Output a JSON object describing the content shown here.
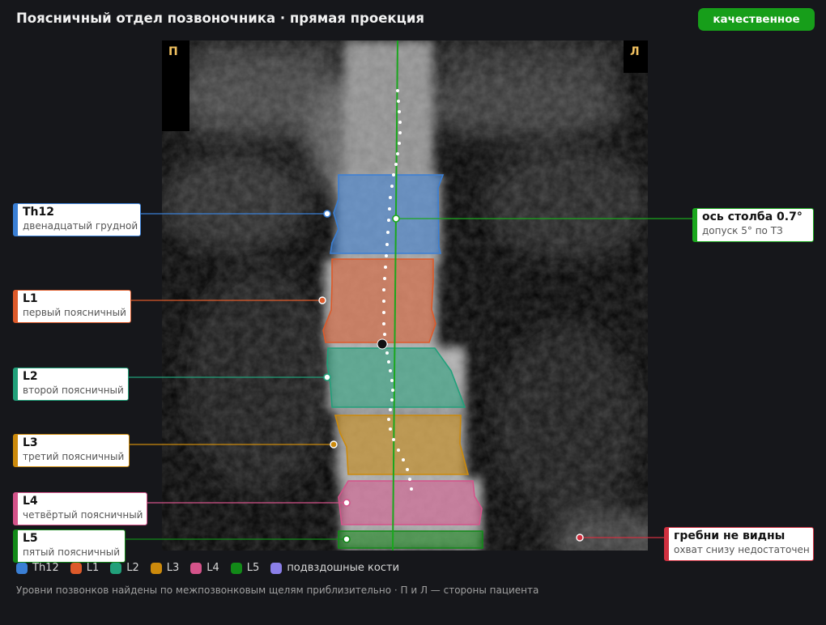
{
  "header": {
    "title": "Поясничный отдел позвоночника · прямая проекция",
    "quality_badge": "качественное"
  },
  "sides": {
    "right": "П",
    "left": "Л"
  },
  "vertebrae": [
    {
      "id": "Th12",
      "name": "Th12",
      "desc": "двенадцатый грудной",
      "color": "#3a7fd5"
    },
    {
      "id": "L1",
      "name": "L1",
      "desc": "первый поясничный",
      "color": "#dd5a2a"
    },
    {
      "id": "L2",
      "name": "L2",
      "desc": "второй поясничный",
      "color": "#21a07a"
    },
    {
      "id": "L3",
      "name": "L3",
      "desc": "третий поясничный",
      "color": "#cc8a0c"
    },
    {
      "id": "L4",
      "name": "L4",
      "desc": "четвёртый поясничный",
      "color": "#d4538a"
    },
    {
      "id": "L5",
      "name": "L5",
      "desc": "пятый поясничный",
      "color": "#128a18"
    }
  ],
  "axis": {
    "title": "ось столба 0.7°",
    "tolerance": "допуск 5° по ТЗ",
    "color": "#1aa71d"
  },
  "iliac": {
    "title": "гребни не видны",
    "subtitle": "охват снизу недостаточен",
    "color": "#d03040"
  },
  "legend": [
    {
      "label": "Th12",
      "color": "#3a7fd5"
    },
    {
      "label": "L1",
      "color": "#dd5a2a"
    },
    {
      "label": "L2",
      "color": "#21a07a"
    },
    {
      "label": "L3",
      "color": "#cc8a0c"
    },
    {
      "label": "L4",
      "color": "#d4538a"
    },
    {
      "label": "L5",
      "color": "#128a18"
    },
    {
      "label": "подвздошные кости",
      "color": "#8b7fe8"
    }
  ],
  "footnote": "Уровни позвонков найдены по межпозвонковым щелям приблизительно · П и Л — стороны пациента"
}
